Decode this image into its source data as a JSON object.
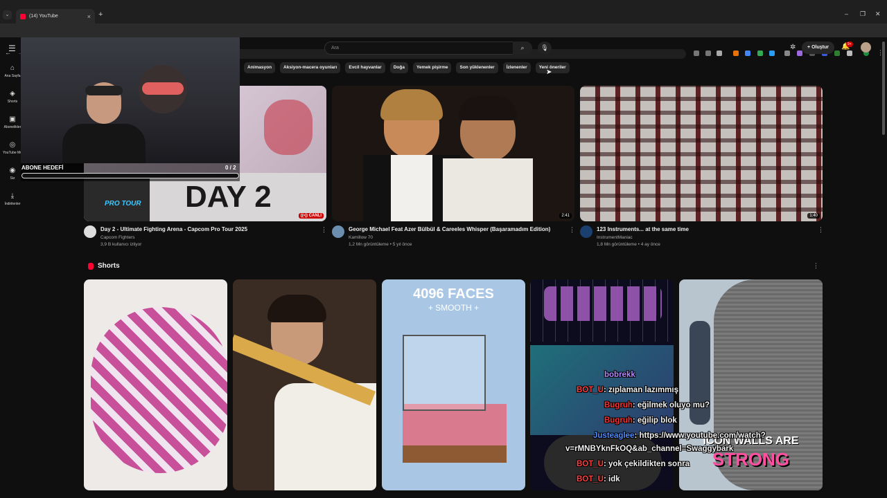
{
  "browser": {
    "tab_title": "(14) YouTube",
    "tab_close": "×",
    "new_tab": "+",
    "url": "youtube.com"
  },
  "header": {
    "search_placeholder": "Ara",
    "create_label": "Oluştur",
    "notification_count": "9+"
  },
  "sidebar": {
    "items": [
      {
        "label": "Ana Sayfa",
        "icon": "home-icon"
      },
      {
        "label": "Shorts",
        "icon": "shorts-icon"
      },
      {
        "label": "Abonelikler",
        "icon": "subscriptions-icon"
      },
      {
        "label": "YouTube Mu",
        "icon": "music-icon"
      },
      {
        "label": "Siz",
        "icon": "you-icon"
      },
      {
        "label": "İndirilenler",
        "icon": "download-icon"
      }
    ]
  },
  "chips": [
    "Animasyon",
    "Aksiyon-macera oyunları",
    "Evcil hayvanlar",
    "Doğa",
    "Yemek pişirme",
    "Son yüklenenler",
    "İzlenenler",
    "Yeni öneriler"
  ],
  "videos": [
    {
      "title": "Day 2 - Ultimate Fighting Arena - Capcom Pro Tour 2025",
      "channel": "Capcom Fighters",
      "stats": "3,9 B kullanıcı izliyor",
      "badge": "CANLI",
      "thumb_text": "DAY 2",
      "thumb_sub": "PRO TOUR"
    },
    {
      "title": "George Michael Feat Azer Bülbül & Careeles Whisper (Başaramadım Edition)",
      "channel": "Kamillow 70",
      "stats": "1,2 Mn görüntüleme • 5 yıl önce",
      "duration": "2:41"
    },
    {
      "title": "123 Instruments... at the same time",
      "channel": "InstrumentManiac",
      "stats": "1,8 Mn görüntüleme • 4 ay önce",
      "duration": "1:40"
    }
  ],
  "shorts": {
    "title": "Shorts",
    "items": [
      {
        "text": ""
      },
      {
        "text": ""
      },
      {
        "text": "4096 FACES",
        "sub": "+ SMOOTH +"
      },
      {
        "text": ""
      },
      {
        "text": "STRONG",
        "sub": "ICON WALLS ARE"
      }
    ]
  },
  "overlay": {
    "goal_label": "ABONE HEDEFİ",
    "goal_count": "0 / 2",
    "goal_progress": 0
  },
  "chat": [
    {
      "user": "bobrekk",
      "msg": "",
      "color": "#b388ff"
    },
    {
      "user": "BOT_U",
      "msg": ": zıplaman lazımmış",
      "color": "#ff4040"
    },
    {
      "user": "Bugruh",
      "msg": ": eğilmek oluyo mu?",
      "color": "#ff3030"
    },
    {
      "user": "Bugruh",
      "msg": ": eğilip blok",
      "color": "#ff3030"
    },
    {
      "user": "Justeaglee",
      "msg": ": https://www.youtube.com/watch?",
      "color": "#4d8cff"
    },
    {
      "user": "",
      "msg": "v=rMNBYknFkOQ&ab_channel=Swaggybark",
      "color": "#ffffff"
    },
    {
      "user": "BOT_U",
      "msg": ": yok çekildikten sonra",
      "color": "#ff4040"
    },
    {
      "user": "BOT_U",
      "msg": ": idk",
      "color": "#ff4040"
    }
  ]
}
